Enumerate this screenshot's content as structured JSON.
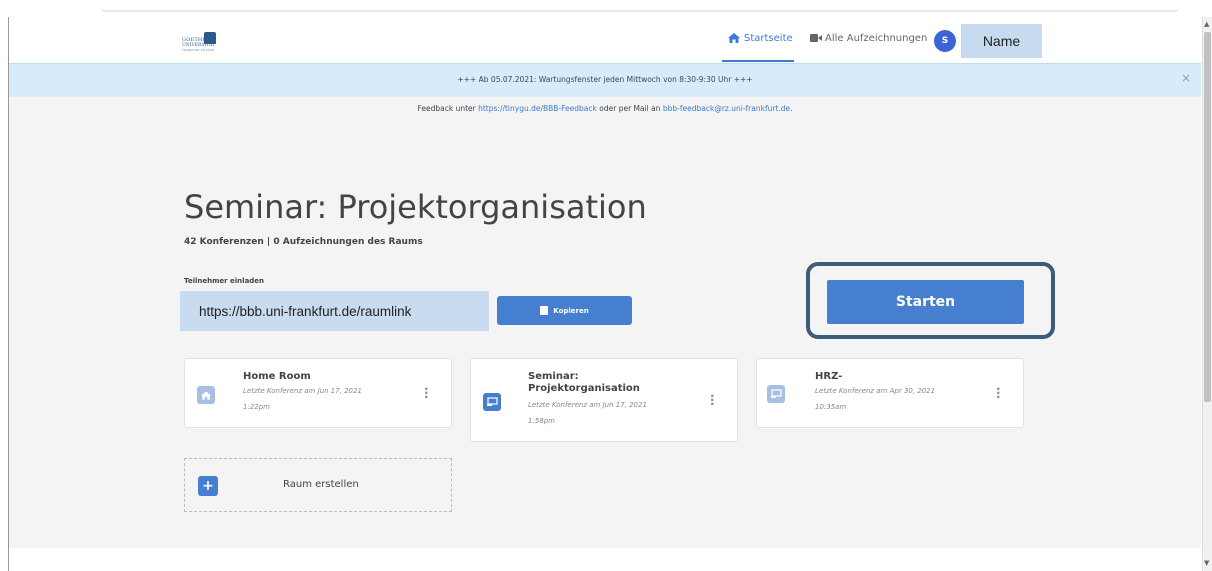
{
  "header": {
    "logo_line1": "GOETHE",
    "logo_line2": "UNIVERSITÄT",
    "logo_line3": "FRANKFURT AM MAIN",
    "nav_home": "Startseite",
    "nav_recordings": "Alle Aufzeichnungen",
    "avatar_initial": "S",
    "user_name": "Name"
  },
  "banner": {
    "text": "+++ Ab 05.07.2021: Wartungsfenster jeden Mittwoch von 8:30-9:30 Uhr +++",
    "close": "×"
  },
  "feedback": {
    "prefix": "Feedback unter ",
    "link": "https://tinygu.de/BBB-Feedback",
    "middle": " oder per Mail an ",
    "email": "bbb-feedback@rz.uni-frankfurt.de",
    "suffix": "."
  },
  "room": {
    "title": "Seminar: Projektorganisation",
    "subtitle": "42 Konferenzen | 0 Aufzeichnungen des Raums",
    "invite_label": "Teilnehmer einladen",
    "invite_link": "https://bbb.uni-frankfurt.de/raumlink",
    "copy_label": "Kopieren",
    "start_label": "Starten"
  },
  "rooms": [
    {
      "title": "Home Room",
      "meta1": "Letzte Konferenz am Jun 17, 2021",
      "meta2": "1:22pm",
      "icon": "home-icon"
    },
    {
      "title": "Seminar: Projektorganisation",
      "meta1": "Letzte Konferenz am Jun 17, 2021",
      "meta2": "1:58pm",
      "icon": "presentation-icon"
    },
    {
      "title": "HRZ-",
      "meta1": "Letzte Konferenz am Apr 30, 2021",
      "meta2": "10:35am",
      "icon": "presentation-icon"
    }
  ],
  "create_room": {
    "label": "Raum erstellen",
    "icon": "+"
  },
  "colors": {
    "primary": "#467fcf",
    "banner": "#d6ecfa",
    "highlight": "#c7dbf0",
    "outline": "#3d5c7a"
  }
}
